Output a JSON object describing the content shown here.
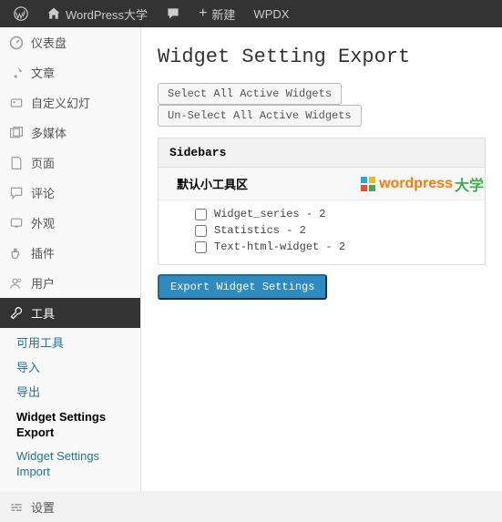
{
  "topbar": {
    "site_name": "WordPress大学",
    "new_label": "新建",
    "wpdx_label": "WPDX"
  },
  "sidebar": {
    "items": [
      {
        "label": "仪表盘",
        "icon": "dashboard"
      },
      {
        "label": "文章",
        "icon": "post"
      },
      {
        "label": "自定义幻灯",
        "icon": "slides"
      },
      {
        "label": "多媒体",
        "icon": "media"
      },
      {
        "label": "页面",
        "icon": "page"
      },
      {
        "label": "评论",
        "icon": "comment"
      },
      {
        "label": "外观",
        "icon": "appearance"
      },
      {
        "label": "插件",
        "icon": "plugin"
      },
      {
        "label": "用户",
        "icon": "user"
      },
      {
        "label": "工具",
        "icon": "tool"
      },
      {
        "label": "设置",
        "icon": "settings"
      }
    ],
    "submenu": {
      "parent_index": 9,
      "items": [
        {
          "label": "可用工具"
        },
        {
          "label": "导入"
        },
        {
          "label": "导出"
        },
        {
          "label": "Widget Settings Export",
          "current": true
        },
        {
          "label": "Widget Settings Import"
        }
      ]
    }
  },
  "page": {
    "title": "Widget Setting Export",
    "select_all_label": "Select All Active Widgets",
    "unselect_all_label": "Un-Select All Active Widgets",
    "panel_header": "Sidebars",
    "panel_sub": "默认小工具区",
    "widgets": [
      {
        "label": "Widget_series - 2"
      },
      {
        "label": "Statistics - 2"
      },
      {
        "label": "Text-html-widget - 2"
      }
    ],
    "export_button": "Export Widget Settings"
  },
  "watermark": {
    "text1": "wordpress",
    "text2": "大学"
  }
}
